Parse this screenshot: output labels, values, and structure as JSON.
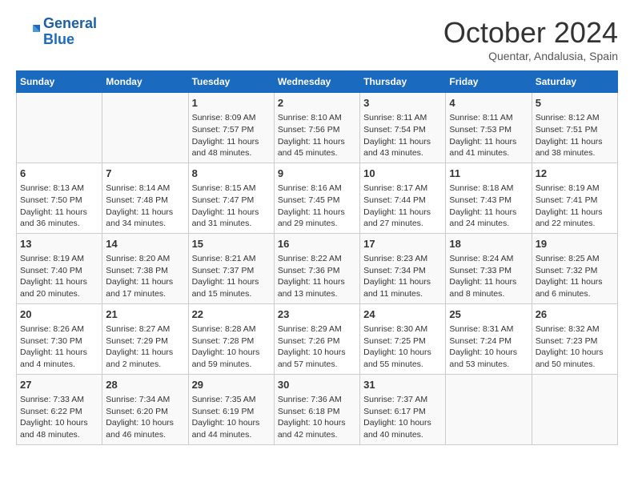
{
  "header": {
    "logo_line1": "General",
    "logo_line2": "Blue",
    "month": "October 2024",
    "location": "Quentar, Andalusia, Spain"
  },
  "columns": [
    "Sunday",
    "Monday",
    "Tuesday",
    "Wednesday",
    "Thursday",
    "Friday",
    "Saturday"
  ],
  "rows": [
    [
      {
        "day": "",
        "text": ""
      },
      {
        "day": "",
        "text": ""
      },
      {
        "day": "1",
        "text": "Sunrise: 8:09 AM\nSunset: 7:57 PM\nDaylight: 11 hours and 48 minutes."
      },
      {
        "day": "2",
        "text": "Sunrise: 8:10 AM\nSunset: 7:56 PM\nDaylight: 11 hours and 45 minutes."
      },
      {
        "day": "3",
        "text": "Sunrise: 8:11 AM\nSunset: 7:54 PM\nDaylight: 11 hours and 43 minutes."
      },
      {
        "day": "4",
        "text": "Sunrise: 8:11 AM\nSunset: 7:53 PM\nDaylight: 11 hours and 41 minutes."
      },
      {
        "day": "5",
        "text": "Sunrise: 8:12 AM\nSunset: 7:51 PM\nDaylight: 11 hours and 38 minutes."
      }
    ],
    [
      {
        "day": "6",
        "text": "Sunrise: 8:13 AM\nSunset: 7:50 PM\nDaylight: 11 hours and 36 minutes."
      },
      {
        "day": "7",
        "text": "Sunrise: 8:14 AM\nSunset: 7:48 PM\nDaylight: 11 hours and 34 minutes."
      },
      {
        "day": "8",
        "text": "Sunrise: 8:15 AM\nSunset: 7:47 PM\nDaylight: 11 hours and 31 minutes."
      },
      {
        "day": "9",
        "text": "Sunrise: 8:16 AM\nSunset: 7:45 PM\nDaylight: 11 hours and 29 minutes."
      },
      {
        "day": "10",
        "text": "Sunrise: 8:17 AM\nSunset: 7:44 PM\nDaylight: 11 hours and 27 minutes."
      },
      {
        "day": "11",
        "text": "Sunrise: 8:18 AM\nSunset: 7:43 PM\nDaylight: 11 hours and 24 minutes."
      },
      {
        "day": "12",
        "text": "Sunrise: 8:19 AM\nSunset: 7:41 PM\nDaylight: 11 hours and 22 minutes."
      }
    ],
    [
      {
        "day": "13",
        "text": "Sunrise: 8:19 AM\nSunset: 7:40 PM\nDaylight: 11 hours and 20 minutes."
      },
      {
        "day": "14",
        "text": "Sunrise: 8:20 AM\nSunset: 7:38 PM\nDaylight: 11 hours and 17 minutes."
      },
      {
        "day": "15",
        "text": "Sunrise: 8:21 AM\nSunset: 7:37 PM\nDaylight: 11 hours and 15 minutes."
      },
      {
        "day": "16",
        "text": "Sunrise: 8:22 AM\nSunset: 7:36 PM\nDaylight: 11 hours and 13 minutes."
      },
      {
        "day": "17",
        "text": "Sunrise: 8:23 AM\nSunset: 7:34 PM\nDaylight: 11 hours and 11 minutes."
      },
      {
        "day": "18",
        "text": "Sunrise: 8:24 AM\nSunset: 7:33 PM\nDaylight: 11 hours and 8 minutes."
      },
      {
        "day": "19",
        "text": "Sunrise: 8:25 AM\nSunset: 7:32 PM\nDaylight: 11 hours and 6 minutes."
      }
    ],
    [
      {
        "day": "20",
        "text": "Sunrise: 8:26 AM\nSunset: 7:30 PM\nDaylight: 11 hours and 4 minutes."
      },
      {
        "day": "21",
        "text": "Sunrise: 8:27 AM\nSunset: 7:29 PM\nDaylight: 11 hours and 2 minutes."
      },
      {
        "day": "22",
        "text": "Sunrise: 8:28 AM\nSunset: 7:28 PM\nDaylight: 10 hours and 59 minutes."
      },
      {
        "day": "23",
        "text": "Sunrise: 8:29 AM\nSunset: 7:26 PM\nDaylight: 10 hours and 57 minutes."
      },
      {
        "day": "24",
        "text": "Sunrise: 8:30 AM\nSunset: 7:25 PM\nDaylight: 10 hours and 55 minutes."
      },
      {
        "day": "25",
        "text": "Sunrise: 8:31 AM\nSunset: 7:24 PM\nDaylight: 10 hours and 53 minutes."
      },
      {
        "day": "26",
        "text": "Sunrise: 8:32 AM\nSunset: 7:23 PM\nDaylight: 10 hours and 50 minutes."
      }
    ],
    [
      {
        "day": "27",
        "text": "Sunrise: 7:33 AM\nSunset: 6:22 PM\nDaylight: 10 hours and 48 minutes."
      },
      {
        "day": "28",
        "text": "Sunrise: 7:34 AM\nSunset: 6:20 PM\nDaylight: 10 hours and 46 minutes."
      },
      {
        "day": "29",
        "text": "Sunrise: 7:35 AM\nSunset: 6:19 PM\nDaylight: 10 hours and 44 minutes."
      },
      {
        "day": "30",
        "text": "Sunrise: 7:36 AM\nSunset: 6:18 PM\nDaylight: 10 hours and 42 minutes."
      },
      {
        "day": "31",
        "text": "Sunrise: 7:37 AM\nSunset: 6:17 PM\nDaylight: 10 hours and 40 minutes."
      },
      {
        "day": "",
        "text": ""
      },
      {
        "day": "",
        "text": ""
      }
    ]
  ]
}
